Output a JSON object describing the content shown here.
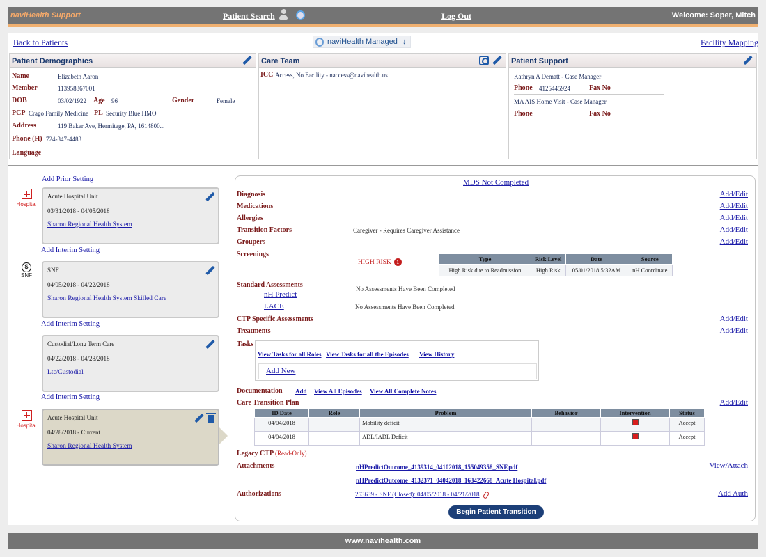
{
  "topbar": {
    "brand": "naviHealth Support",
    "patient_search": "Patient Search",
    "log_out": "Log Out",
    "welcome": "Welcome: Soper, Mitch"
  },
  "nav": {
    "back": "Back to Patients",
    "managed": "naviHealth Managed",
    "managed_arrow": "↓",
    "facility_mapping": "Facility Mapping"
  },
  "demographics": {
    "title": "Patient Demographics",
    "name_label": "Name",
    "name": "Elizabeth Aaron",
    "member_label": "Member",
    "member": "113958367001",
    "dob_label": "DOB",
    "dob": "03/02/1922",
    "age_label": "Age",
    "age": "96",
    "gender_label": "Gender",
    "gender": "Female",
    "pcp_label": "PCP",
    "pcp": "Crago Family Medicine",
    "pl_label": "PL",
    "pl": "Security Blue HMO",
    "address_label": "Address",
    "address": "119 Baker Ave, Hermitage, PA, 1614800...",
    "phone_label": "Phone (H)",
    "phone": "724-347-4483",
    "language_label": "Language"
  },
  "care_team": {
    "title": "Care Team",
    "icc_label": "ICC",
    "icc": "Access, No Facility - naccess@navihealth.us"
  },
  "patient_support": {
    "title": "Patient Support",
    "contact1": "Kathryn A Dematt - Case Manager",
    "phone_label": "Phone",
    "phone1": "4125445924",
    "fax_label": "Fax No",
    "contact2": "MA AIS Home Visit - Case Manager"
  },
  "timeline": {
    "add_prior": "Add Prior Setting",
    "add_interim": "Add Interim Setting",
    "hospital_icon_label": "Hospital",
    "snf_icon_label": "SNF",
    "settings": [
      {
        "title": "Acute Hospital Unit",
        "dates": "03/31/2018 - 04/05/2018",
        "facility": "Sharon Regional Health System"
      },
      {
        "title": "SNF",
        "dates": "04/05/2018 - 04/22/2018",
        "facility": "Sharon Regional Health System Skilled Care"
      },
      {
        "title": "Custodial/Long Term Care",
        "dates": "04/22/2018 - 04/28/2018",
        "facility": "Ltc/Custodial"
      },
      {
        "title": "Acute Hospital Unit",
        "dates": "04/28/2018 - Current",
        "facility": "Sharon Regional Health System"
      }
    ]
  },
  "episode": {
    "mds": "MDS Not Completed",
    "add_edit": "Add/Edit",
    "diagnosis": "Diagnosis",
    "medications": "Medications",
    "allergies": "Allergies",
    "transition_factors": "Transition Factors",
    "transition_factors_value": "Caregiver - Requires Caregiver Assistance",
    "groupers": "Groupers",
    "screenings": "Screenings",
    "high_risk": "HIGH RISK",
    "risk_count": "1",
    "risk_table": {
      "headers": [
        "Type",
        "Risk Level",
        "Date",
        "Source"
      ],
      "row": [
        "High Risk due to Readmission",
        "High Risk",
        "05/01/2018 5:32AM",
        "nH Coordinate"
      ]
    },
    "standard_assessments": "Standard Assessments",
    "nh_predict": "nH Predict",
    "lace": "LACE",
    "no_assessments": "No Assessments Have Been Completed",
    "ctp_specific": "CTP Specific Assessments",
    "treatments": "Treatments",
    "tasks": "Tasks",
    "view_tasks_roles": "View Tasks for all Roles",
    "view_tasks_episodes": "View Tasks for all the Episodes",
    "view_history": "View History",
    "add_new": "Add New",
    "documentation": "Documentation",
    "doc_add": "Add",
    "view_all_episodes": "View All Episodes",
    "view_all_notes": "View All Complete Notes",
    "ctp": "Care Transition Plan",
    "ctp_table": {
      "headers": [
        "ID Date",
        "Role",
        "Problem",
        "Behavior",
        "Intervention",
        "Status"
      ],
      "rows": [
        [
          "04/04/2018",
          "",
          "Mobility deficit",
          "",
          "",
          "Accept"
        ],
        [
          "04/04/2018",
          "",
          "ADL/IADL Deficit",
          "",
          "",
          "Accept"
        ]
      ]
    },
    "legacy_ctp": "Legacy CTP",
    "read_only": "(Read-Only)",
    "attachments": "Attachments",
    "view_attach": "View/Attach",
    "attachment1": "nHPredictOutcome_4139314_04102018_155049358_SNF.pdf",
    "attachment2": "nHPredictOutcome_4132371_04042018_163422668_Acute Hospital.pdf",
    "authorizations": "Authorizations",
    "auth1": "253639 - SNF (Closed): 04/05/2018 - 04/21/2018",
    "add_auth": "Add Auth",
    "begin": "Begin Patient Transition"
  },
  "footer": {
    "link": "www.navihealth.com"
  },
  "colors": {
    "topbar": "#747474",
    "brand": "#f4a96a",
    "label": "#7a1a1a",
    "link": "#1a1aa8",
    "button": "#1c3f78"
  }
}
